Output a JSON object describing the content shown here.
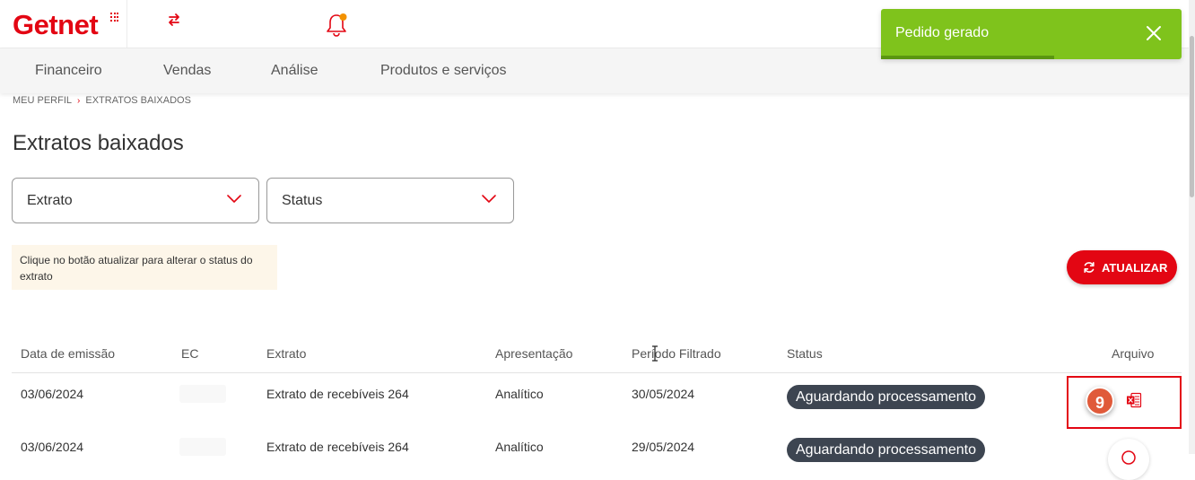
{
  "header": {
    "logo_text": "Getnet",
    "brand_color": "#e30613",
    "notification_icon": "bell-icon",
    "switch_icon": "swap-arrows-icon"
  },
  "nav": {
    "items": [
      {
        "label": "Financeiro"
      },
      {
        "label": "Vendas"
      },
      {
        "label": "Análise"
      },
      {
        "label": "Produtos e serviços"
      }
    ]
  },
  "toast": {
    "message": "Pedido gerado",
    "color": "#7fc31c",
    "close_icon": "close-icon"
  },
  "breadcrumb": {
    "items": [
      "MEU PERFIL",
      "EXTRATOS BAIXADOS"
    ],
    "separator": "›"
  },
  "page": {
    "title": "Extratos baixados"
  },
  "filters": {
    "extrato_label": "Extrato",
    "status_label": "Status"
  },
  "info": {
    "text": "Clique no botão atualizar para alterar o status do extrato"
  },
  "actions": {
    "refresh_label": "ATUALIZAR"
  },
  "table": {
    "headers": [
      "Data de emissão",
      "EC",
      "Extrato",
      "Apresentação",
      "Período Filtrado",
      "Status",
      "Arquivo"
    ],
    "rows": [
      {
        "date": "03/06/2024",
        "ec": "",
        "extrato": "Extrato de recebíveis 264",
        "apresentacao": "Analítico",
        "periodo": "30/05/2024",
        "status": "Aguardando processamento"
      },
      {
        "date": "03/06/2024",
        "ec": "",
        "extrato": "Extrato de recebíveis 264",
        "apresentacao": "Analítico",
        "periodo": "29/05/2024",
        "status": "Aguardando processamento"
      }
    ]
  },
  "annotation": {
    "step_number": "9",
    "highlight_color": "#e30613"
  }
}
